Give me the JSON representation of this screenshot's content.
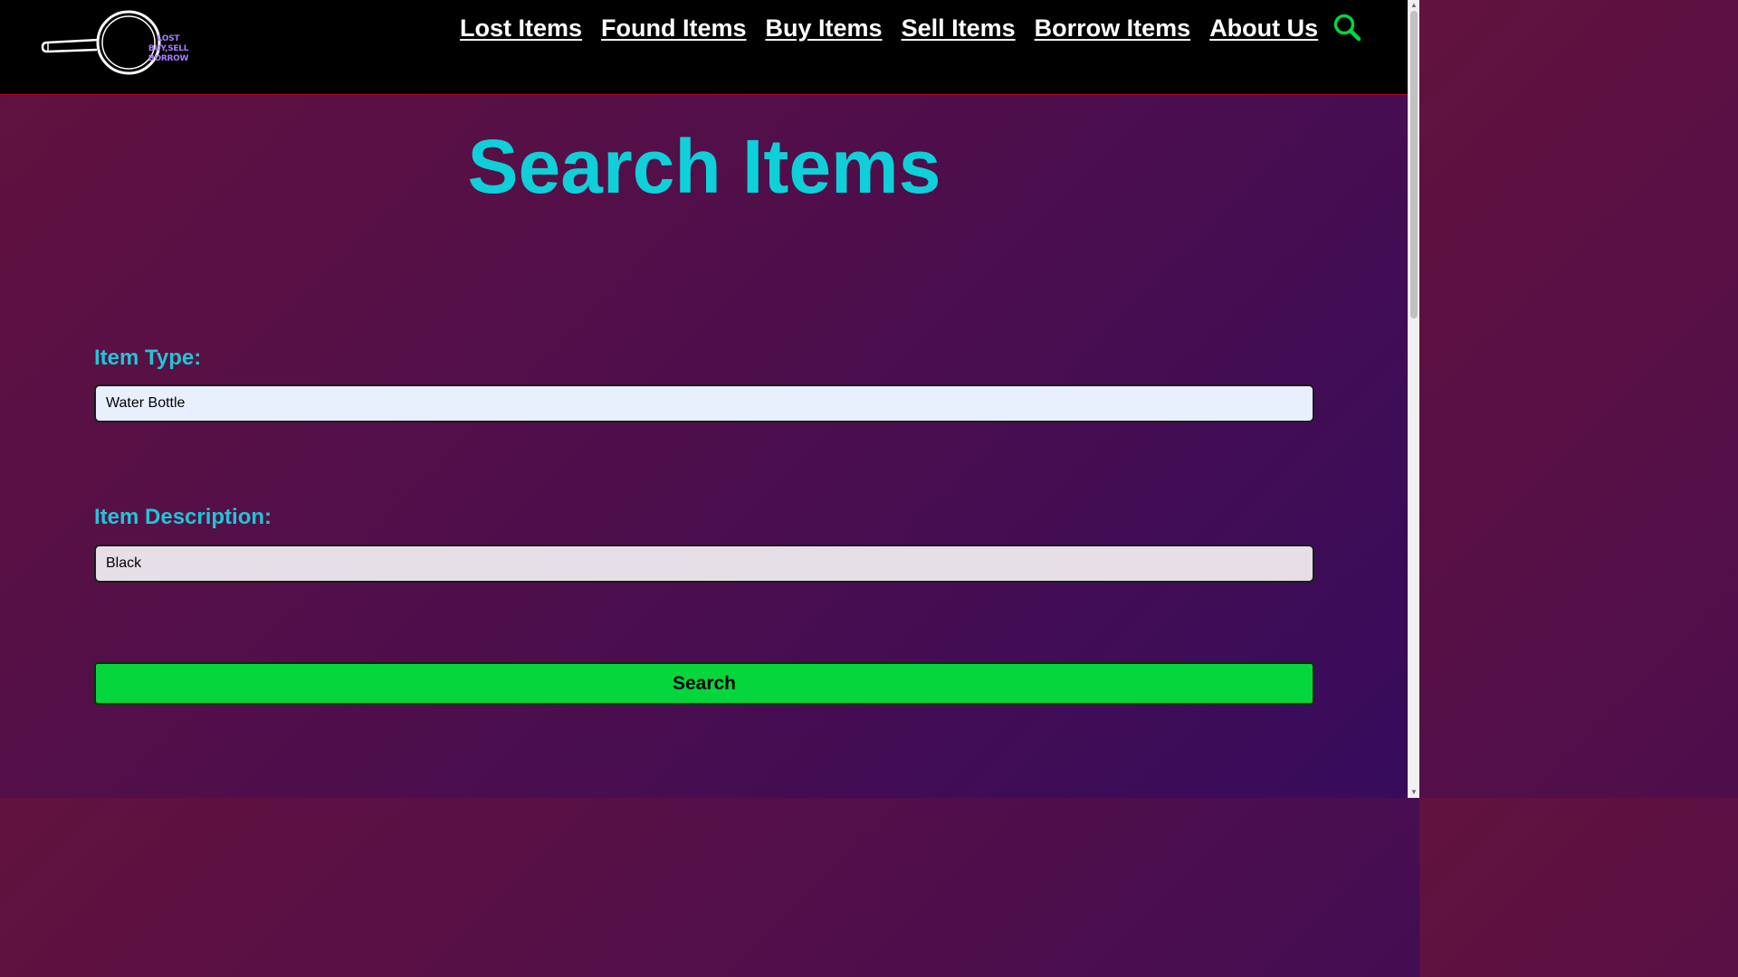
{
  "logo": {
    "text_line1": "LOST",
    "text_line2": "BUY,SELL",
    "text_line3": "BORROW",
    "icon": "magnifying-glass-logo"
  },
  "nav": {
    "items": [
      {
        "label": "Lost Items"
      },
      {
        "label": "Found Items"
      },
      {
        "label": "Buy Items"
      },
      {
        "label": "Sell Items"
      },
      {
        "label": "Borrow Items"
      },
      {
        "label": "About Us"
      }
    ],
    "search_icon": "search-icon"
  },
  "page": {
    "title": "Search Items"
  },
  "form": {
    "item_type_label": "Item Type:",
    "item_type_value": "Water Bottle",
    "item_description_label": "Item Description:",
    "item_description_value": "Black",
    "search_button_label": "Search"
  },
  "colors": {
    "header_bg": "#000000",
    "title": "#0fd0d9",
    "label": "#21c5d6",
    "button": "#05d63c",
    "search_icon": "#05d63c",
    "background_start": "#62123e",
    "background_end": "#360c5c"
  }
}
